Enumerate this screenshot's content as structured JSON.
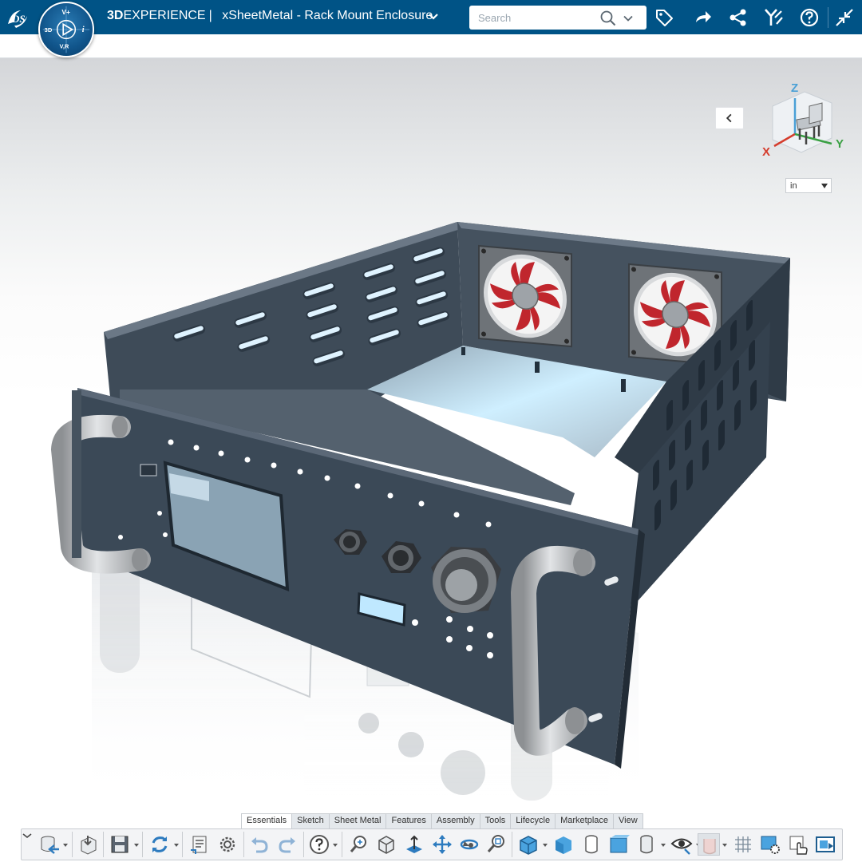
{
  "header": {
    "brand_bold": "3D",
    "brand_rest": "EXPERIENCE",
    "separator": "|",
    "app_title": "xSheetMetal - Rack Mount Enclosure",
    "search_placeholder": "Search",
    "compass_labels": {
      "top": "V+",
      "left": "3D",
      "right": "i",
      "bottom": "V,R"
    }
  },
  "viewport": {
    "unit": "in",
    "axes": {
      "x": "X",
      "y": "Y",
      "z": "Z"
    }
  },
  "tabs": [
    {
      "label": "Essentials",
      "active": true
    },
    {
      "label": "Sketch",
      "active": false
    },
    {
      "label": "Sheet Metal",
      "active": false
    },
    {
      "label": "Features",
      "active": false
    },
    {
      "label": "Assembly",
      "active": false
    },
    {
      "label": "Tools",
      "active": false
    },
    {
      "label": "Lifecycle",
      "active": false
    },
    {
      "label": "Marketplace",
      "active": false
    },
    {
      "label": "View",
      "active": false
    }
  ],
  "toolbar_icons": [
    "data-store-icon",
    "import-icon",
    "save-icon",
    "refresh-icon",
    "properties-icon",
    "settings-gear-icon",
    "undo-icon",
    "redo-icon",
    "help-icon",
    "zoom-fit-icon",
    "view-orientation-icon",
    "normal-to-icon",
    "pan-icon",
    "rotate-icon",
    "zoom-area-icon",
    "shaded-with-edges-icon",
    "shaded-icon",
    "wireframe-icon",
    "shaded-faces-icon",
    "hidden-lines-icon",
    "visibility-eye-icon",
    "transparency-icon",
    "grid-icon",
    "render-settings-icon",
    "hand-tool-icon",
    "screenshot-icon"
  ],
  "colors": {
    "header_bg": "#005386",
    "panel_metal": "#3b4957",
    "fan_blade": "#c0262d",
    "handle": "#b9bcbf",
    "display_screen": "#bfe8ff",
    "toolbar_icon": "#2d7bbf"
  }
}
